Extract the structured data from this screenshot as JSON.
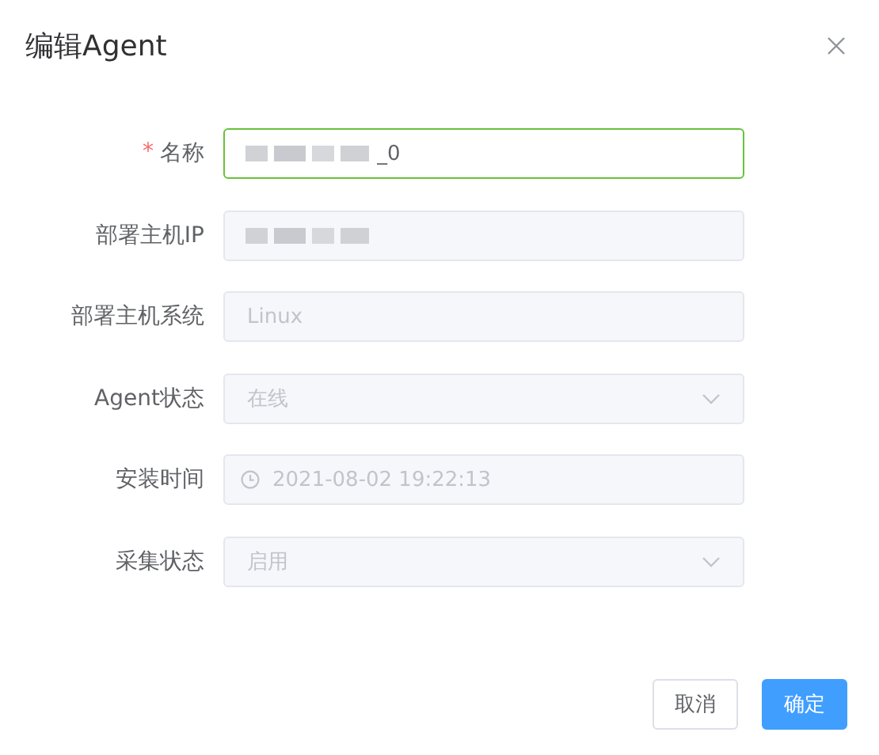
{
  "dialog": {
    "title": "编辑Agent",
    "fields": [
      {
        "label": "名称",
        "required_mark": "*",
        "kind": "text",
        "value": "_0",
        "redacted": true,
        "focused": true,
        "disabled": false
      },
      {
        "label": "部署主机IP",
        "kind": "text",
        "redacted": true,
        "disabled": true
      },
      {
        "label": "部署主机系统",
        "kind": "text",
        "placeholder": "Linux",
        "disabled": true
      },
      {
        "label": "Agent状态",
        "kind": "select",
        "value": "在线",
        "disabled": true
      },
      {
        "label": "安装时间",
        "kind": "date",
        "value": "2021-08-02 19:22:13",
        "disabled": true
      },
      {
        "label": "采集状态",
        "kind": "select",
        "value": "启用",
        "disabled": true
      }
    ],
    "buttons": [
      {
        "label": "取消",
        "kind": "default"
      },
      {
        "label": "确定",
        "kind": "primary"
      }
    ]
  }
}
